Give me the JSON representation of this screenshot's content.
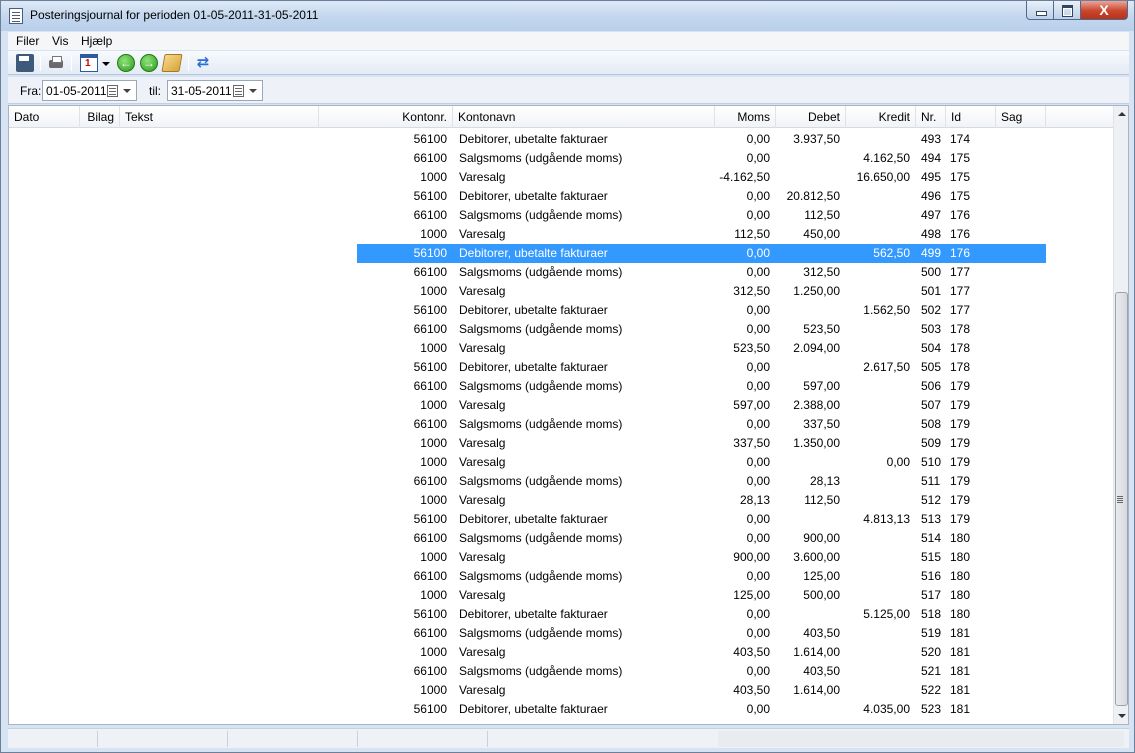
{
  "window": {
    "title": "Posteringsjournal for perioden 01-05-2011-31-05-2011",
    "close_glyph": "X"
  },
  "menu": {
    "items": [
      {
        "label": "Filer"
      },
      {
        "label": "Vis"
      },
      {
        "label": "Hjælp"
      }
    ]
  },
  "toolbar": {
    "icons": [
      "save-icon",
      "print-icon",
      "calendar-icon",
      "back-icon",
      "forward-icon",
      "journal-icon",
      "refresh-icon"
    ],
    "back_glyph": "←",
    "forward_glyph": "→",
    "refresh_glyph": "⇄"
  },
  "filter": {
    "from_label": "Fra:",
    "from_value": "01-05-2011",
    "to_label": "til:",
    "to_value": "31-05-2011"
  },
  "grid": {
    "columns": [
      "Dato",
      "Bilag",
      "Tekst",
      "Kontonr.",
      "Kontonavn",
      "Moms",
      "Debet",
      "Kredit",
      "Nr.",
      "Id",
      "Sag"
    ],
    "selected_row_index": 6,
    "rows": [
      {
        "kontonr": "56100",
        "kontonavn": "Debitorer, ubetalte fakturaer",
        "moms": "0,00",
        "debet": "3.937,50",
        "kredit": "",
        "nr": "493",
        "id": "174"
      },
      {
        "kontonr": "66100",
        "kontonavn": "Salgsmoms (udgående moms)",
        "moms": "0,00",
        "debet": "",
        "kredit": "4.162,50",
        "nr": "494",
        "id": "175"
      },
      {
        "kontonr": "1000",
        "kontonavn": "Varesalg",
        "moms": "-4.162,50",
        "debet": "",
        "kredit": "16.650,00",
        "nr": "495",
        "id": "175"
      },
      {
        "kontonr": "56100",
        "kontonavn": "Debitorer, ubetalte fakturaer",
        "moms": "0,00",
        "debet": "20.812,50",
        "kredit": "",
        "nr": "496",
        "id": "175"
      },
      {
        "kontonr": "66100",
        "kontonavn": "Salgsmoms (udgående moms)",
        "moms": "0,00",
        "debet": "112,50",
        "kredit": "",
        "nr": "497",
        "id": "176"
      },
      {
        "kontonr": "1000",
        "kontonavn": "Varesalg",
        "moms": "112,50",
        "debet": "450,00",
        "kredit": "",
        "nr": "498",
        "id": "176"
      },
      {
        "kontonr": "56100",
        "kontonavn": "Debitorer, ubetalte fakturaer",
        "moms": "0,00",
        "debet": "",
        "kredit": "562,50",
        "nr": "499",
        "id": "176"
      },
      {
        "kontonr": "66100",
        "kontonavn": "Salgsmoms (udgående moms)",
        "moms": "0,00",
        "debet": "312,50",
        "kredit": "",
        "nr": "500",
        "id": "177"
      },
      {
        "kontonr": "1000",
        "kontonavn": "Varesalg",
        "moms": "312,50",
        "debet": "1.250,00",
        "kredit": "",
        "nr": "501",
        "id": "177"
      },
      {
        "kontonr": "56100",
        "kontonavn": "Debitorer, ubetalte fakturaer",
        "moms": "0,00",
        "debet": "",
        "kredit": "1.562,50",
        "nr": "502",
        "id": "177"
      },
      {
        "kontonr": "66100",
        "kontonavn": "Salgsmoms (udgående moms)",
        "moms": "0,00",
        "debet": "523,50",
        "kredit": "",
        "nr": "503",
        "id": "178"
      },
      {
        "kontonr": "1000",
        "kontonavn": "Varesalg",
        "moms": "523,50",
        "debet": "2.094,00",
        "kredit": "",
        "nr": "504",
        "id": "178"
      },
      {
        "kontonr": "56100",
        "kontonavn": "Debitorer, ubetalte fakturaer",
        "moms": "0,00",
        "debet": "",
        "kredit": "2.617,50",
        "nr": "505",
        "id": "178"
      },
      {
        "kontonr": "66100",
        "kontonavn": "Salgsmoms (udgående moms)",
        "moms": "0,00",
        "debet": "597,00",
        "kredit": "",
        "nr": "506",
        "id": "179"
      },
      {
        "kontonr": "1000",
        "kontonavn": "Varesalg",
        "moms": "597,00",
        "debet": "2.388,00",
        "kredit": "",
        "nr": "507",
        "id": "179"
      },
      {
        "kontonr": "66100",
        "kontonavn": "Salgsmoms (udgående moms)",
        "moms": "0,00",
        "debet": "337,50",
        "kredit": "",
        "nr": "508",
        "id": "179"
      },
      {
        "kontonr": "1000",
        "kontonavn": "Varesalg",
        "moms": "337,50",
        "debet": "1.350,00",
        "kredit": "",
        "nr": "509",
        "id": "179"
      },
      {
        "kontonr": "1000",
        "kontonavn": "Varesalg",
        "moms": "0,00",
        "debet": "",
        "kredit": "0,00",
        "nr": "510",
        "id": "179"
      },
      {
        "kontonr": "66100",
        "kontonavn": "Salgsmoms (udgående moms)",
        "moms": "0,00",
        "debet": "28,13",
        "kredit": "",
        "nr": "511",
        "id": "179"
      },
      {
        "kontonr": "1000",
        "kontonavn": "Varesalg",
        "moms": "28,13",
        "debet": "112,50",
        "kredit": "",
        "nr": "512",
        "id": "179"
      },
      {
        "kontonr": "56100",
        "kontonavn": "Debitorer, ubetalte fakturaer",
        "moms": "0,00",
        "debet": "",
        "kredit": "4.813,13",
        "nr": "513",
        "id": "179"
      },
      {
        "kontonr": "66100",
        "kontonavn": "Salgsmoms (udgående moms)",
        "moms": "0,00",
        "debet": "900,00",
        "kredit": "",
        "nr": "514",
        "id": "180"
      },
      {
        "kontonr": "1000",
        "kontonavn": "Varesalg",
        "moms": "900,00",
        "debet": "3.600,00",
        "kredit": "",
        "nr": "515",
        "id": "180"
      },
      {
        "kontonr": "66100",
        "kontonavn": "Salgsmoms (udgående moms)",
        "moms": "0,00",
        "debet": "125,00",
        "kredit": "",
        "nr": "516",
        "id": "180"
      },
      {
        "kontonr": "1000",
        "kontonavn": "Varesalg",
        "moms": "125,00",
        "debet": "500,00",
        "kredit": "",
        "nr": "517",
        "id": "180"
      },
      {
        "kontonr": "56100",
        "kontonavn": "Debitorer, ubetalte fakturaer",
        "moms": "0,00",
        "debet": "",
        "kredit": "5.125,00",
        "nr": "518",
        "id": "180"
      },
      {
        "kontonr": "66100",
        "kontonavn": "Salgsmoms (udgående moms)",
        "moms": "0,00",
        "debet": "403,50",
        "kredit": "",
        "nr": "519",
        "id": "181"
      },
      {
        "kontonr": "1000",
        "kontonavn": "Varesalg",
        "moms": "403,50",
        "debet": "1.614,00",
        "kredit": "",
        "nr": "520",
        "id": "181"
      },
      {
        "kontonr": "66100",
        "kontonavn": "Salgsmoms (udgående moms)",
        "moms": "0,00",
        "debet": "403,50",
        "kredit": "",
        "nr": "521",
        "id": "181"
      },
      {
        "kontonr": "1000",
        "kontonavn": "Varesalg",
        "moms": "403,50",
        "debet": "1.614,00",
        "kredit": "",
        "nr": "522",
        "id": "181"
      },
      {
        "kontonr": "56100",
        "kontonavn": "Debitorer, ubetalte fakturaer",
        "moms": "0,00",
        "debet": "",
        "kredit": "4.035,00",
        "nr": "523",
        "id": "181"
      }
    ]
  },
  "colors": {
    "selection": "#3399ff",
    "titlebar": "#c3d6ee",
    "close_button": "#c9452c"
  }
}
